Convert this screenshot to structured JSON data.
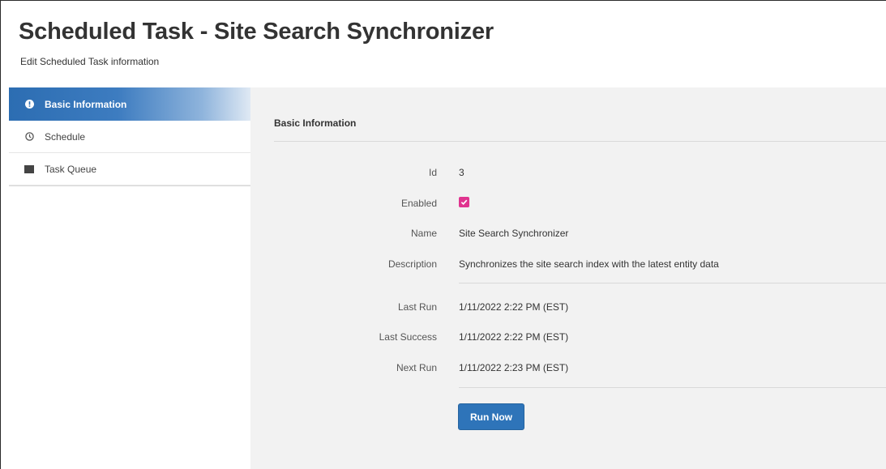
{
  "header": {
    "title": "Scheduled Task - Site Search Synchronizer",
    "subtitle": "Edit Scheduled Task information"
  },
  "sidebar": {
    "items": [
      {
        "label": "Basic Information",
        "icon": "info-circle-icon",
        "active": true
      },
      {
        "label": "Schedule",
        "icon": "clock-icon",
        "active": false
      },
      {
        "label": "Task Queue",
        "icon": "list-icon",
        "active": false
      }
    ]
  },
  "main": {
    "section_title": "Basic Information",
    "fields": {
      "id": {
        "label": "Id",
        "value": "3"
      },
      "enabled": {
        "label": "Enabled",
        "checked": true
      },
      "name": {
        "label": "Name",
        "value": "Site Search Synchronizer"
      },
      "description": {
        "label": "Description",
        "value": "Synchronizes the site search index with the latest entity data"
      },
      "last_run": {
        "label": "Last Run",
        "value": "1/11/2022 2:22 PM (EST)"
      },
      "last_success": {
        "label": "Last Success",
        "value": "1/11/2022 2:22 PM (EST)"
      },
      "next_run": {
        "label": "Next Run",
        "value": "1/11/2022 2:23 PM (EST)"
      }
    },
    "run_now_label": "Run Now"
  },
  "colors": {
    "accent": "#2e74b9",
    "checkbox": "#e0348f",
    "panel_bg": "#f2f2f2"
  }
}
